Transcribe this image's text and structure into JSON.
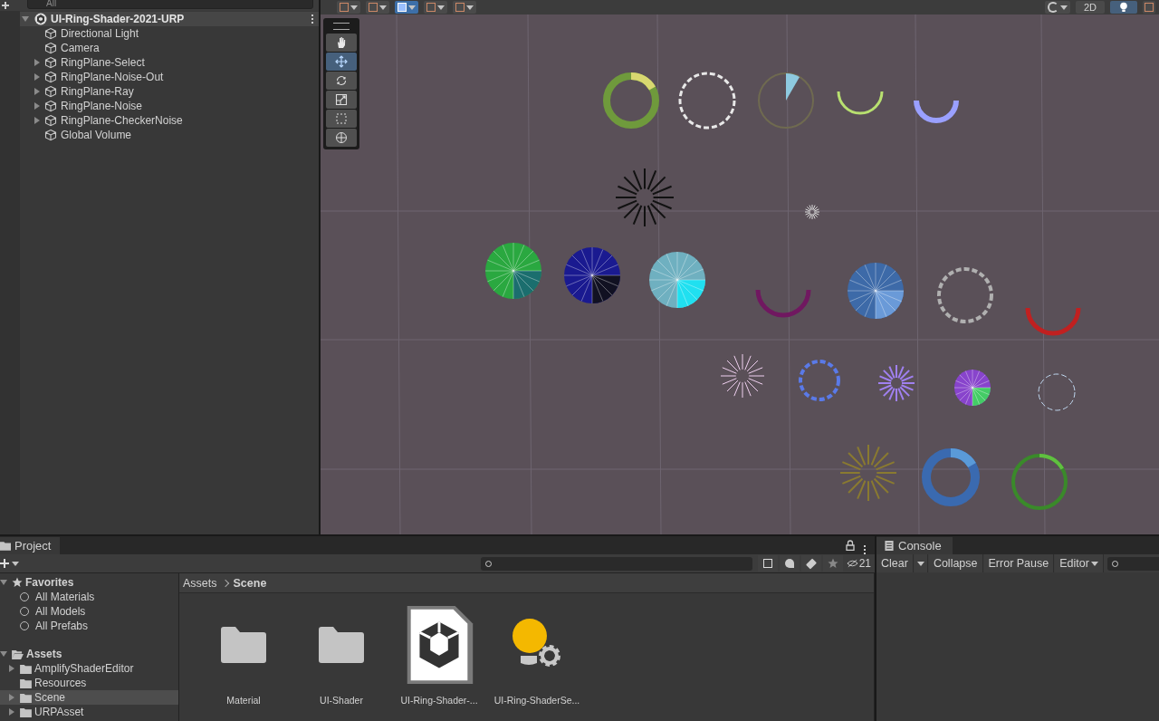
{
  "hierarchy": {
    "search": {
      "placeholder": "All"
    },
    "scene": {
      "name": "UI-Ring-Shader-2021-URP",
      "expanded": true
    },
    "items": [
      {
        "name": "Directional Light",
        "has_children": false
      },
      {
        "name": "Camera",
        "has_children": false
      },
      {
        "name": "RingPlane-Select",
        "has_children": true
      },
      {
        "name": "RingPlane-Noise-Out",
        "has_children": true
      },
      {
        "name": "RingPlane-Ray",
        "has_children": true
      },
      {
        "name": "RingPlane-Noise",
        "has_children": true
      },
      {
        "name": "RingPlane-CheckerNoise",
        "has_children": true
      },
      {
        "name": "Global Volume",
        "has_children": false
      }
    ]
  },
  "scene_toolbar": {
    "mode_2d": {
      "label": "2D",
      "selected": false
    },
    "lighting": {
      "on": true
    },
    "gizmo_snap": {
      "selected": true
    }
  },
  "tools": [
    {
      "kind": "hand",
      "selected": false
    },
    {
      "kind": "move",
      "selected": true
    },
    {
      "kind": "rotate",
      "selected": false
    },
    {
      "kind": "scale",
      "selected": false
    },
    {
      "kind": "rect",
      "selected": false
    },
    {
      "kind": "transform",
      "selected": false
    }
  ],
  "project": {
    "tab": "Project",
    "hidden_count": "21",
    "favorites": {
      "label": "Favorites",
      "items": [
        "All Materials",
        "All Models",
        "All Prefabs"
      ]
    },
    "assets": {
      "label": "Assets",
      "children": [
        {
          "name": "AmplifyShaderEditor",
          "has_children": true,
          "selected": false
        },
        {
          "name": "Resources",
          "has_children": false,
          "selected": false
        },
        {
          "name": "Scene",
          "has_children": true,
          "selected": true
        },
        {
          "name": "URPAsset",
          "has_children": true,
          "selected": false
        }
      ]
    },
    "breadcrumb": [
      "Assets",
      "Scene"
    ],
    "files": [
      {
        "name": "Material",
        "kind": "folder"
      },
      {
        "name": "UI-Shader",
        "kind": "folder"
      },
      {
        "name": "UI-Ring-Shader-...",
        "kind": "scene"
      },
      {
        "name": "UI-Ring-ShaderSe...",
        "kind": "settings"
      }
    ]
  },
  "console": {
    "tab": "Console",
    "buttons": [
      {
        "label": "Clear",
        "kind": "split"
      },
      {
        "label": "Collapse",
        "kind": "toggle"
      },
      {
        "label": "Error Pause",
        "kind": "toggle"
      },
      {
        "label": "Editor",
        "kind": "dropdown"
      }
    ]
  }
}
